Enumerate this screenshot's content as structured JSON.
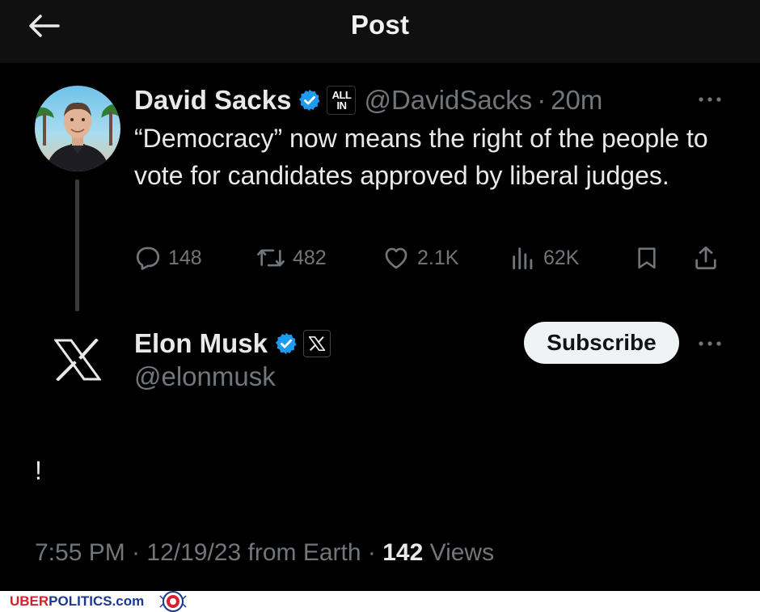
{
  "header": {
    "title": "Post"
  },
  "parent_post": {
    "display_name": "David Sacks",
    "affiliation_badge": [
      "ALL",
      "IN"
    ],
    "handle": "@DavidSacks",
    "separator": "·",
    "time": "20m",
    "text": "“Democracy” now means the right of the people to vote for candidates approved by liberal judges.",
    "actions": {
      "replies": "148",
      "reposts": "482",
      "likes": "2.1K",
      "views": "62K"
    }
  },
  "main_post": {
    "display_name": "Elon Musk",
    "handle": "@elonmusk",
    "subscribe_label": "Subscribe",
    "text": "!",
    "timestamp": "7:55 PM · 12/19/23 from Earth · ",
    "views_count": "142",
    "views_label": " Views"
  },
  "watermark": {
    "brand_part1": "UBER",
    "brand_part2": "POLITICS.com"
  },
  "colors": {
    "verified_blue": "#1d9bf0",
    "muted": "#71767b",
    "text": "#e7e9ea",
    "background": "#000000"
  },
  "icons": [
    "back-arrow-icon",
    "verified-icon",
    "more-icon",
    "reply-icon",
    "repost-icon",
    "like-icon",
    "views-icon",
    "bookmark-icon",
    "share-icon",
    "x-logo-icon"
  ]
}
